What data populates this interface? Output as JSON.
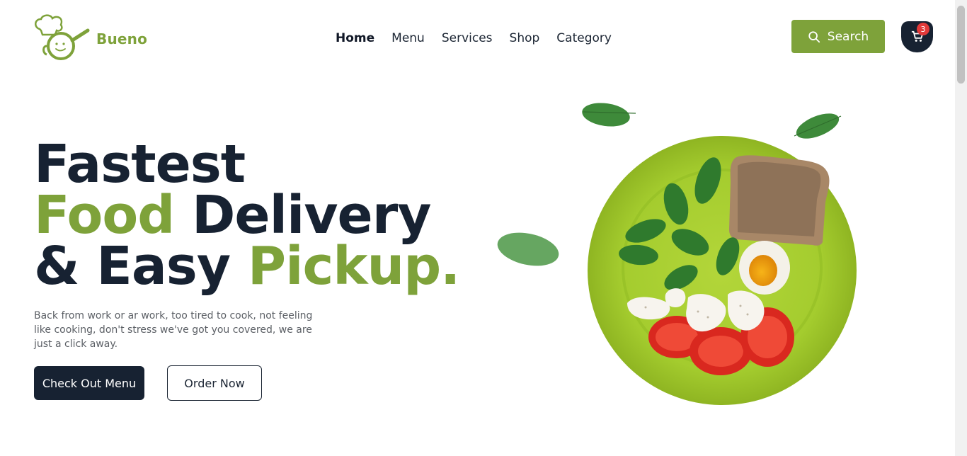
{
  "brand": {
    "name": "Bueno",
    "logo_icon": "chef-pan-icon",
    "color": "#7ea23a"
  },
  "nav": {
    "items": [
      {
        "label": "Home",
        "active": true
      },
      {
        "label": "Menu",
        "active": false
      },
      {
        "label": "Services",
        "active": false
      },
      {
        "label": "Shop",
        "active": false
      },
      {
        "label": "Category",
        "active": false
      }
    ]
  },
  "header": {
    "search_label": "Search",
    "cart_count": "3"
  },
  "hero": {
    "line1": "Fastest",
    "line2_green": "Food",
    "line2_dark": "Delivery",
    "line3_dark": "& Easy",
    "line3_green": "Pickup.",
    "description": "Back from work or ar work, too tired to cook, not feeling like cooking, don't stress we've got you covered, we are just a click away.",
    "primary_button": "Check Out Menu",
    "secondary_button": "Order Now"
  },
  "colors": {
    "accent": "#7ea23a",
    "dark": "#172232",
    "badge": "#e33a3a"
  }
}
